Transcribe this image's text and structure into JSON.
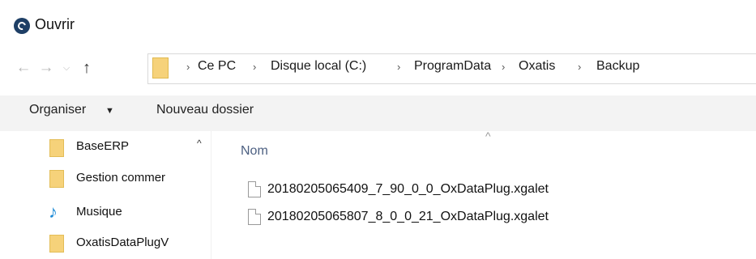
{
  "window": {
    "title": "Ouvrir",
    "app_icon": "app-logo-icon"
  },
  "nav_buttons": {
    "back": "←",
    "forward": "→",
    "recent": "⌵",
    "up": "↑"
  },
  "breadcrumb": {
    "separator": "›",
    "items": [
      "Ce PC",
      "Disque local (C:)",
      "ProgramData",
      "Oxatis",
      "Backup"
    ]
  },
  "toolbar": {
    "organise_label": "Organiser",
    "organise_caret": "▼",
    "new_folder_label": "Nouveau dossier"
  },
  "nav_pane": {
    "scroll_up": "^",
    "items": [
      {
        "label": "BaseERP",
        "icon": "folder-icon"
      },
      {
        "label": "Gestion commer",
        "icon": "folder-icon"
      },
      {
        "label": "Musique",
        "icon": "music-icon"
      },
      {
        "label": "OxatisDataPlugV",
        "icon": "folder-icon"
      }
    ]
  },
  "file_list": {
    "sort_caret": "^",
    "column_name": "Nom",
    "files": [
      "20180205065409_7_90_0_0_OxDataPlug.xgalet",
      "20180205065807_8_0_0_21_OxDataPlug.xgalet"
    ]
  },
  "colors": {
    "folder": "#f6d27a",
    "toolbar_bg": "#f3f3f3",
    "column_header": "#4d6082",
    "music": "#1c8ad6"
  }
}
